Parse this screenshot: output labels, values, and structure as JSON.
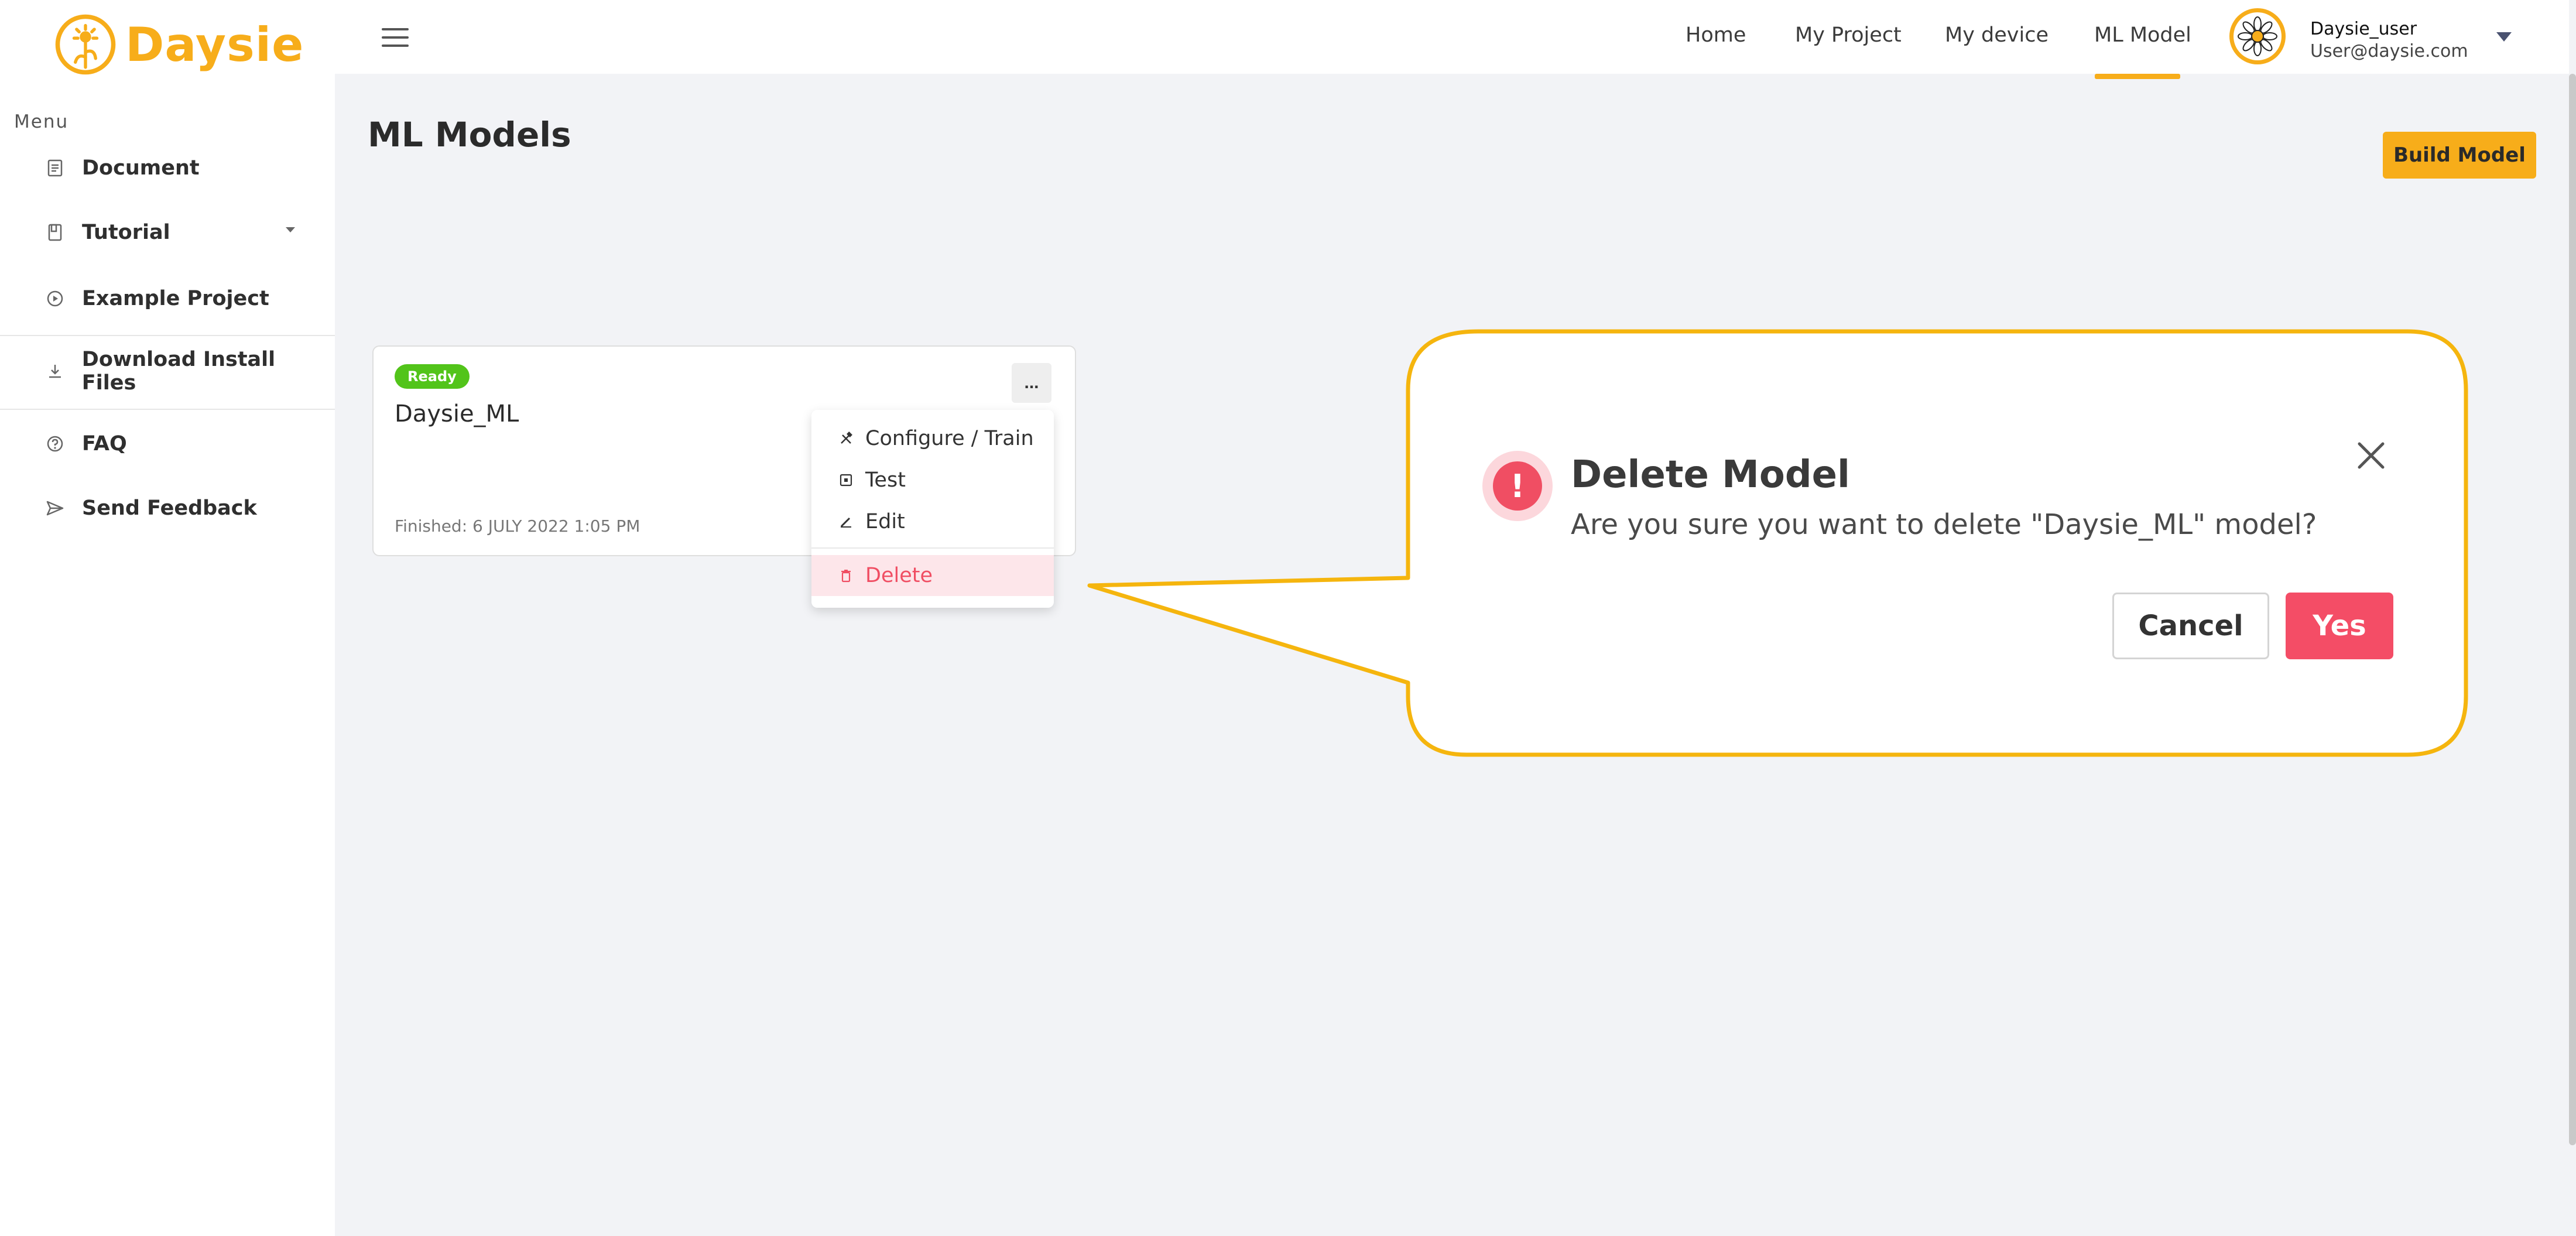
{
  "brand": {
    "name": "Daysie",
    "color": "#f7ad1a"
  },
  "sidebar": {
    "menu_heading": "Menu",
    "items": [
      {
        "label": "Document",
        "icon": "document-icon"
      },
      {
        "label": "Tutorial",
        "icon": "book-icon",
        "expandable": true
      },
      {
        "label": "Example Project",
        "icon": "play-circle-icon"
      },
      {
        "label": "Download Install Files",
        "icon": "download-icon"
      },
      {
        "label": "FAQ",
        "icon": "question-circle-icon"
      },
      {
        "label": "Send Feedback",
        "icon": "send-icon"
      }
    ]
  },
  "topbar": {
    "nav": [
      "Home",
      "My Project",
      "My device",
      "ML Model"
    ],
    "active_nav": "ML Model",
    "user": {
      "name": "Daysie_user",
      "email": "User@daysie.com"
    }
  },
  "main": {
    "title": "ML Models",
    "build_button": "Build Model"
  },
  "model_card": {
    "status": "Ready",
    "status_color": "#52c41a",
    "name": "Daysie_ML",
    "finished": "Finished: 6 JULY 2022 1:05 PM",
    "more_label": "..."
  },
  "dropdown": {
    "items": [
      {
        "label": "Configure / Train",
        "icon": "tools-icon"
      },
      {
        "label": "Test",
        "icon": "test-icon"
      },
      {
        "label": "Edit",
        "icon": "edit-icon"
      },
      {
        "label": "Delete",
        "icon": "trash-icon",
        "danger": true
      }
    ]
  },
  "dialog": {
    "title": "Delete Model",
    "message": "Are you sure you want to delete \"Daysie_ML\" model?",
    "cancel": "Cancel",
    "confirm": "Yes",
    "confirm_color": "#f44d66",
    "icon": "exclamation-icon"
  }
}
